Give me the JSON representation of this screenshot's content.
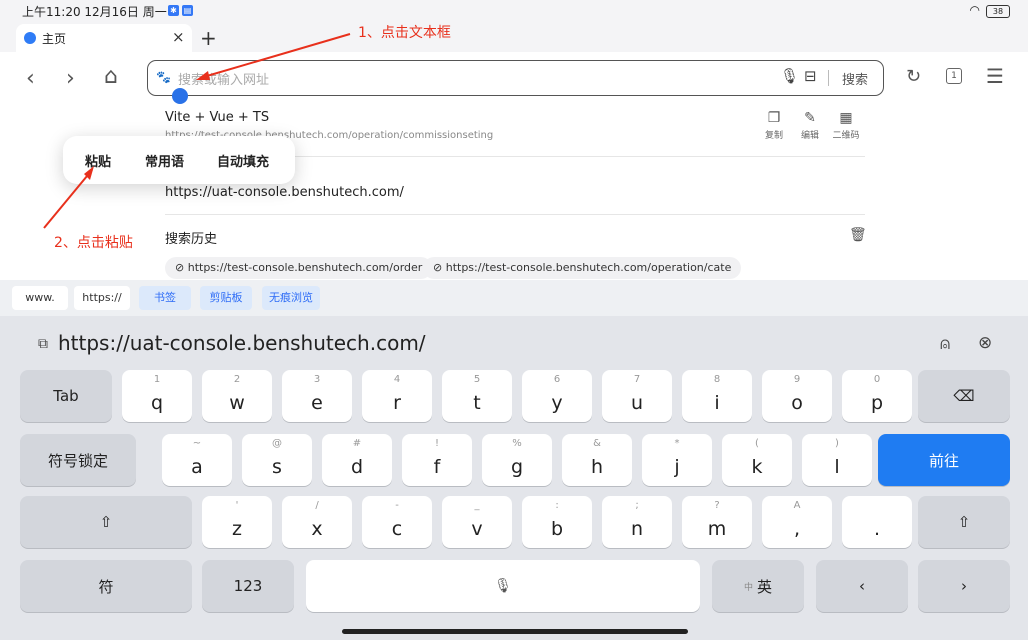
{
  "status": {
    "time": "上午11:20 12月16日 周一",
    "battery": "38"
  },
  "tab": {
    "title": "主页"
  },
  "address": {
    "placeholder": "搜索或输入网址",
    "search_label": "搜索"
  },
  "suggestion_top": {
    "title": "Vite + Vue + TS",
    "url": "https://test-console.benshutech.com/operation/commissionseting",
    "actions": [
      "复制",
      "编辑",
      "二维码"
    ]
  },
  "clipboard_suggestion": "https://uat-console.benshutech.com/",
  "popup": {
    "items": [
      "粘贴",
      "常用语",
      "自动填充"
    ]
  },
  "history": {
    "title": "搜索历史",
    "chips": [
      "https://test-console.benshutech.com/order",
      "https://test-console.benshutech.com/operation/cate"
    ]
  },
  "quickbar": [
    "www.",
    "https://",
    "书签",
    "剪贴板",
    "无痕浏览"
  ],
  "keyboard": {
    "clip_text": "https://uat-console.benshutech.com/",
    "tab": "Tab",
    "lock": "符号锁定",
    "go": "前往",
    "sym": "符",
    "num": "123",
    "lang": "英",
    "lang_hint": "中",
    "row1": [
      {
        "h": "1",
        "k": "q"
      },
      {
        "h": "2",
        "k": "w"
      },
      {
        "h": "3",
        "k": "e"
      },
      {
        "h": "4",
        "k": "r"
      },
      {
        "h": "5",
        "k": "t"
      },
      {
        "h": "6",
        "k": "y"
      },
      {
        "h": "7",
        "k": "u"
      },
      {
        "h": "8",
        "k": "i"
      },
      {
        "h": "9",
        "k": "o"
      },
      {
        "h": "0",
        "k": "p"
      }
    ],
    "row2": [
      {
        "h": "~",
        "k": "a"
      },
      {
        "h": "@",
        "k": "s"
      },
      {
        "h": "#",
        "k": "d"
      },
      {
        "h": "!",
        "k": "f"
      },
      {
        "h": "%",
        "k": "g"
      },
      {
        "h": "&",
        "k": "h"
      },
      {
        "h": "*",
        "k": "j"
      },
      {
        "h": "(",
        "k": "k"
      },
      {
        "h": ")",
        "k": "l"
      }
    ],
    "row3": [
      {
        "h": "'",
        "k": "z"
      },
      {
        "h": "/",
        "k": "x"
      },
      {
        "h": "-",
        "k": "c"
      },
      {
        "h": "_",
        "k": "v"
      },
      {
        "h": ":",
        "k": "b"
      },
      {
        "h": ";",
        "k": "n"
      },
      {
        "h": "?",
        "k": "m"
      },
      {
        "h": "A",
        "k": ","
      },
      {
        "h": "",
        "k": "."
      }
    ]
  },
  "annotations": {
    "step1": "1、点击文本框",
    "step2": "2、点击粘贴"
  },
  "colors": {
    "accent": "#1f7cf2",
    "annotation": "#e8301c"
  }
}
